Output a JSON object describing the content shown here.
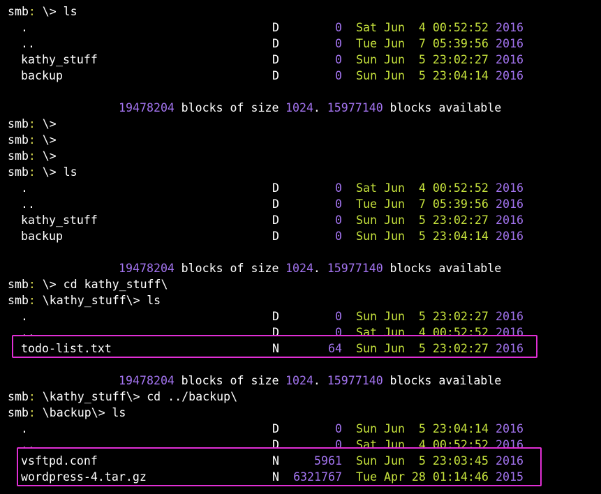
{
  "window": {
    "background": "#000000",
    "text_color": "#e6e6e6"
  },
  "colors": {
    "prompt_label": "#ffffff",
    "prompt_colon": "#d8d850",
    "path": "#ffffff",
    "number": "#a374f0",
    "date": "#c6e23c",
    "year": "#a374f0",
    "highlight_box": "#e02fd4"
  },
  "lines": [
    {
      "kind": "prompt",
      "label": "smb",
      "colon": ":",
      "path": "\\>",
      "command": "ls"
    },
    {
      "kind": "entry",
      "name": ".",
      "attr": "D",
      "size": "0",
      "date": "Sat Jun  4 00:52:52",
      "year": "2016"
    },
    {
      "kind": "entry",
      "name": "..",
      "attr": "D",
      "size": "0",
      "date": "Tue Jun  7 05:39:56",
      "year": "2016"
    },
    {
      "kind": "entry",
      "name": "kathy_stuff",
      "attr": "D",
      "size": "0",
      "date": "Sun Jun  5 23:02:27",
      "year": "2016"
    },
    {
      "kind": "entry",
      "name": "backup",
      "attr": "D",
      "size": "0",
      "date": "Sun Jun  5 23:04:14",
      "year": "2016"
    },
    {
      "kind": "blank"
    },
    {
      "kind": "blocks",
      "blocks": "19478204",
      "text1": "blocks of size",
      "size": "1024",
      "dot": ".",
      "avail": "15977140",
      "text2": "blocks available"
    },
    {
      "kind": "prompt",
      "label": "smb",
      "colon": ":",
      "path": "\\>",
      "command": ""
    },
    {
      "kind": "prompt",
      "label": "smb",
      "colon": ":",
      "path": "\\>",
      "command": ""
    },
    {
      "kind": "prompt",
      "label": "smb",
      "colon": ":",
      "path": "\\>",
      "command": ""
    },
    {
      "kind": "prompt",
      "label": "smb",
      "colon": ":",
      "path": "\\>",
      "command": "ls"
    },
    {
      "kind": "entry",
      "name": ".",
      "attr": "D",
      "size": "0",
      "date": "Sat Jun  4 00:52:52",
      "year": "2016"
    },
    {
      "kind": "entry",
      "name": "..",
      "attr": "D",
      "size": "0",
      "date": "Tue Jun  7 05:39:56",
      "year": "2016"
    },
    {
      "kind": "entry",
      "name": "kathy_stuff",
      "attr": "D",
      "size": "0",
      "date": "Sun Jun  5 23:02:27",
      "year": "2016"
    },
    {
      "kind": "entry",
      "name": "backup",
      "attr": "D",
      "size": "0",
      "date": "Sun Jun  5 23:04:14",
      "year": "2016"
    },
    {
      "kind": "blank"
    },
    {
      "kind": "blocks",
      "blocks": "19478204",
      "text1": "blocks of size",
      "size": "1024",
      "dot": ".",
      "avail": "15977140",
      "text2": "blocks available"
    },
    {
      "kind": "prompt",
      "label": "smb",
      "colon": ":",
      "path": "\\>",
      "command": "cd kathy_stuff\\"
    },
    {
      "kind": "prompt",
      "label": "smb",
      "colon": ":",
      "path": "\\kathy_stuff\\>",
      "command": "ls"
    },
    {
      "kind": "entry",
      "name": ".",
      "attr": "D",
      "size": "0",
      "date": "Sun Jun  5 23:02:27",
      "year": "2016"
    },
    {
      "kind": "entry",
      "name": "..",
      "attr": "D",
      "size": "0",
      "date": "Sat Jun  4 00:52:52",
      "year": "2016"
    },
    {
      "kind": "entry",
      "name": "todo-list.txt",
      "attr": "N",
      "size": "64",
      "date": "Sun Jun  5 23:02:27",
      "year": "2016"
    },
    {
      "kind": "blank"
    },
    {
      "kind": "blocks",
      "blocks": "19478204",
      "text1": "blocks of size",
      "size": "1024",
      "dot": ".",
      "avail": "15977140",
      "text2": "blocks available"
    },
    {
      "kind": "prompt",
      "label": "smb",
      "colon": ":",
      "path": "\\kathy_stuff\\>",
      "command": "cd ../backup\\"
    },
    {
      "kind": "prompt",
      "label": "smb",
      "colon": ":",
      "path": "\\backup\\>",
      "command": "ls"
    },
    {
      "kind": "entry",
      "name": ".",
      "attr": "D",
      "size": "0",
      "date": "Sun Jun  5 23:04:14",
      "year": "2016"
    },
    {
      "kind": "entry",
      "name": "..",
      "attr": "D",
      "size": "0",
      "date": "Sat Jun  4 00:52:52",
      "year": "2016"
    },
    {
      "kind": "entry",
      "name": "vsftpd.conf",
      "attr": "N",
      "size": "5961",
      "date": "Sun Jun  5 23:03:45",
      "year": "2016"
    },
    {
      "kind": "entry",
      "name": "wordpress-4.tar.gz",
      "attr": "N",
      "size": "6321767",
      "date": "Tue Apr 28 01:14:46",
      "year": "2015"
    }
  ],
  "highlights": [
    {
      "label": "todo-list-highlight",
      "from_line": 21,
      "to_line": 21
    },
    {
      "label": "backup-files-highlight",
      "from_line": 28,
      "to_line": 29
    }
  ]
}
